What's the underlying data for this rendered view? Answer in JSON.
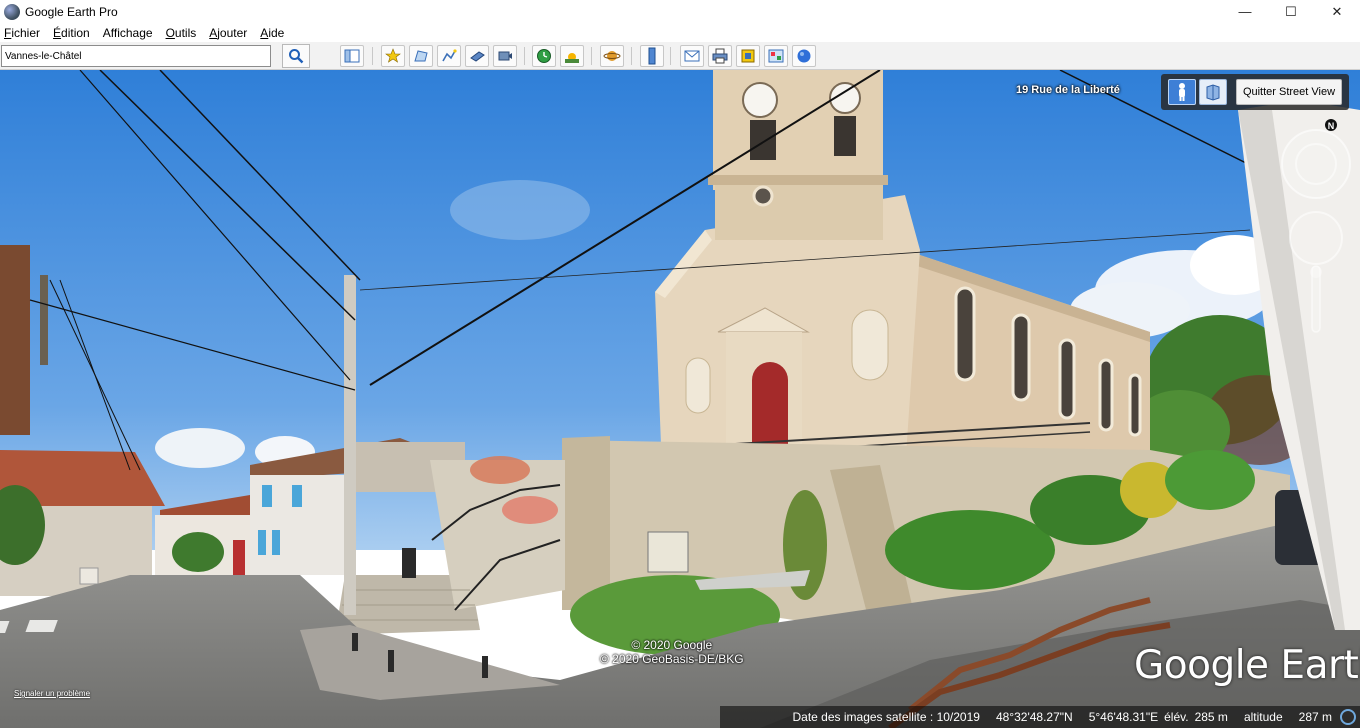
{
  "window": {
    "title": "Google Earth Pro",
    "minimize": "—",
    "maximize": "☐",
    "close": "✕"
  },
  "menu": [
    {
      "accel": "F",
      "rest": "ichier"
    },
    {
      "accel": "É",
      "rest": "dition"
    },
    {
      "accel": "",
      "rest": "Affichage"
    },
    {
      "accel": "O",
      "rest": "utils"
    },
    {
      "accel": "A",
      "rest": "jouter"
    },
    {
      "accel": "A",
      "rest": "ide"
    }
  ],
  "search": {
    "value": "Vannes-le-Châtel"
  },
  "toolbar": {
    "icons": [
      "sidebar-toggle-icon",
      "add-placemark-icon",
      "add-polygon-icon",
      "add-path-icon",
      "add-image-overlay-icon",
      "record-tour-icon",
      "historical-imagery-icon",
      "sunlight-icon",
      "planets-icon",
      "ruler-icon",
      "email-icon",
      "print-icon",
      "save-image-icon",
      "view-in-maps-icon",
      "sky-icon"
    ]
  },
  "streetview": {
    "address": "19 Rue de la Liberté",
    "exit_label": "Quitter Street View"
  },
  "nav": {
    "north": "N"
  },
  "copyright": {
    "line1": "© 2020 Google",
    "line2": "© 2020 GeoBasis-DE/BKG"
  },
  "report": "Signaler un problème",
  "logo": "Google Earth",
  "status": {
    "date_label": "Date des images satellite : 10/2019",
    "lat": "48°32'48.27\"N",
    "lon": "5°46'48.31\"E",
    "elev_label": "élév.",
    "elev_value": "285 m",
    "alt_label": "altitude",
    "alt_value": "287 m"
  },
  "colors": {
    "sky_top": "#2f7fd8",
    "sky_bottom": "#a9cdf0",
    "church_wall": "#e1cfb2",
    "door": "#a42a2a",
    "road": "#8d8d8b"
  }
}
